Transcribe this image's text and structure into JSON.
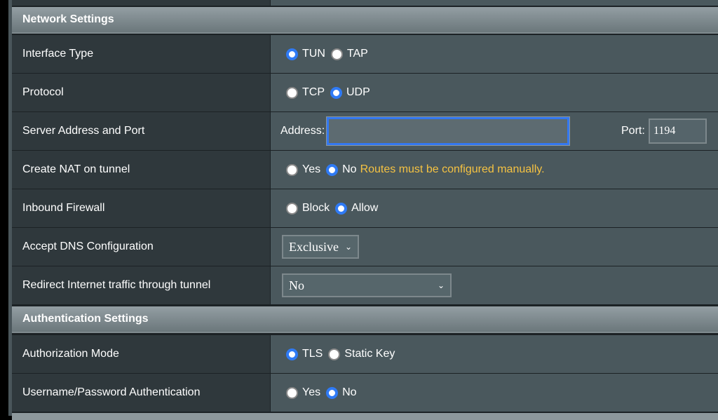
{
  "network": {
    "title": "Network Settings",
    "interface_type": {
      "label": "Interface Type",
      "options": [
        "TUN",
        "TAP"
      ],
      "selected": "TUN"
    },
    "protocol": {
      "label": "Protocol",
      "options": [
        "TCP",
        "UDP"
      ],
      "selected": "UDP"
    },
    "server": {
      "label": "Server Address and Port",
      "address_label": "Address:",
      "address_value": "",
      "port_label": "Port:",
      "port_value": "1194"
    },
    "nat": {
      "label": "Create NAT on tunnel",
      "options": [
        "Yes",
        "No"
      ],
      "selected": "No",
      "note": "Routes must be configured manually."
    },
    "firewall": {
      "label": "Inbound Firewall",
      "options": [
        "Block",
        "Allow"
      ],
      "selected": "Allow"
    },
    "dns": {
      "label": "Accept DNS Configuration",
      "value": "Exclusive"
    },
    "redirect": {
      "label": "Redirect Internet traffic through tunnel",
      "value": "No"
    }
  },
  "auth": {
    "title": "Authentication Settings",
    "mode": {
      "label": "Authorization Mode",
      "options": [
        "TLS",
        "Static Key"
      ],
      "selected": "TLS"
    },
    "userpass": {
      "label": "Username/Password Authentication",
      "options": [
        "Yes",
        "No"
      ],
      "selected": "No"
    }
  },
  "colors": {
    "accent": "#2f7af5",
    "note": "#f5c242"
  }
}
